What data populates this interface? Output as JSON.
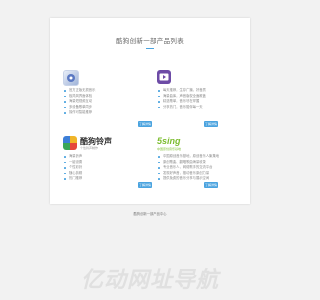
{
  "page": {
    "title": "酷狗创新一部产品列表"
  },
  "products": [
    {
      "name": "product-1",
      "items": [
        "官方正版无损音乐",
        "极简风界面体验",
        "海量短视频互动",
        "多设备歌单同步",
        "操作可智能推荐"
      ],
      "button": "了解详情"
    },
    {
      "name": "product-2",
      "items": [
        "每天推荐，生存广播，好音质",
        "海量曲库，声音版权全面覆盖",
        "精选歌单，音乐尽在掌握",
        "分享热门，音乐陪伴每一天"
      ],
      "button": "了解详情"
    },
    {
      "name": "product-3",
      "logo_text": "酷狗铃声",
      "logo_sub": "个性铃声制作",
      "items": [
        "海量铃声",
        "一键设置",
        "个性彩铃",
        "随心剪辑",
        "热门推荐"
      ],
      "button": "了解详情"
    },
    {
      "name": "product-4",
      "logo_text": "5sing",
      "logo_sub": "中国原创音乐基地",
      "items": [
        "中国原创音乐基地，原创音乐人聚集地",
        "原创歌曲、翻唱歌曲海量收录",
        "专业音乐人，网络歌手的交流平台",
        "发现好声音，推动音乐原创力量",
        "提供免费的音乐分享与展示空间"
      ],
      "button": "了解详情"
    }
  ],
  "footer": {
    "text": "酷狗创新一部产品中心"
  },
  "brand": {
    "text": "亿动网址导航"
  },
  "colors": {
    "accent": "#4aa3df",
    "background": "#f2f2f2"
  }
}
